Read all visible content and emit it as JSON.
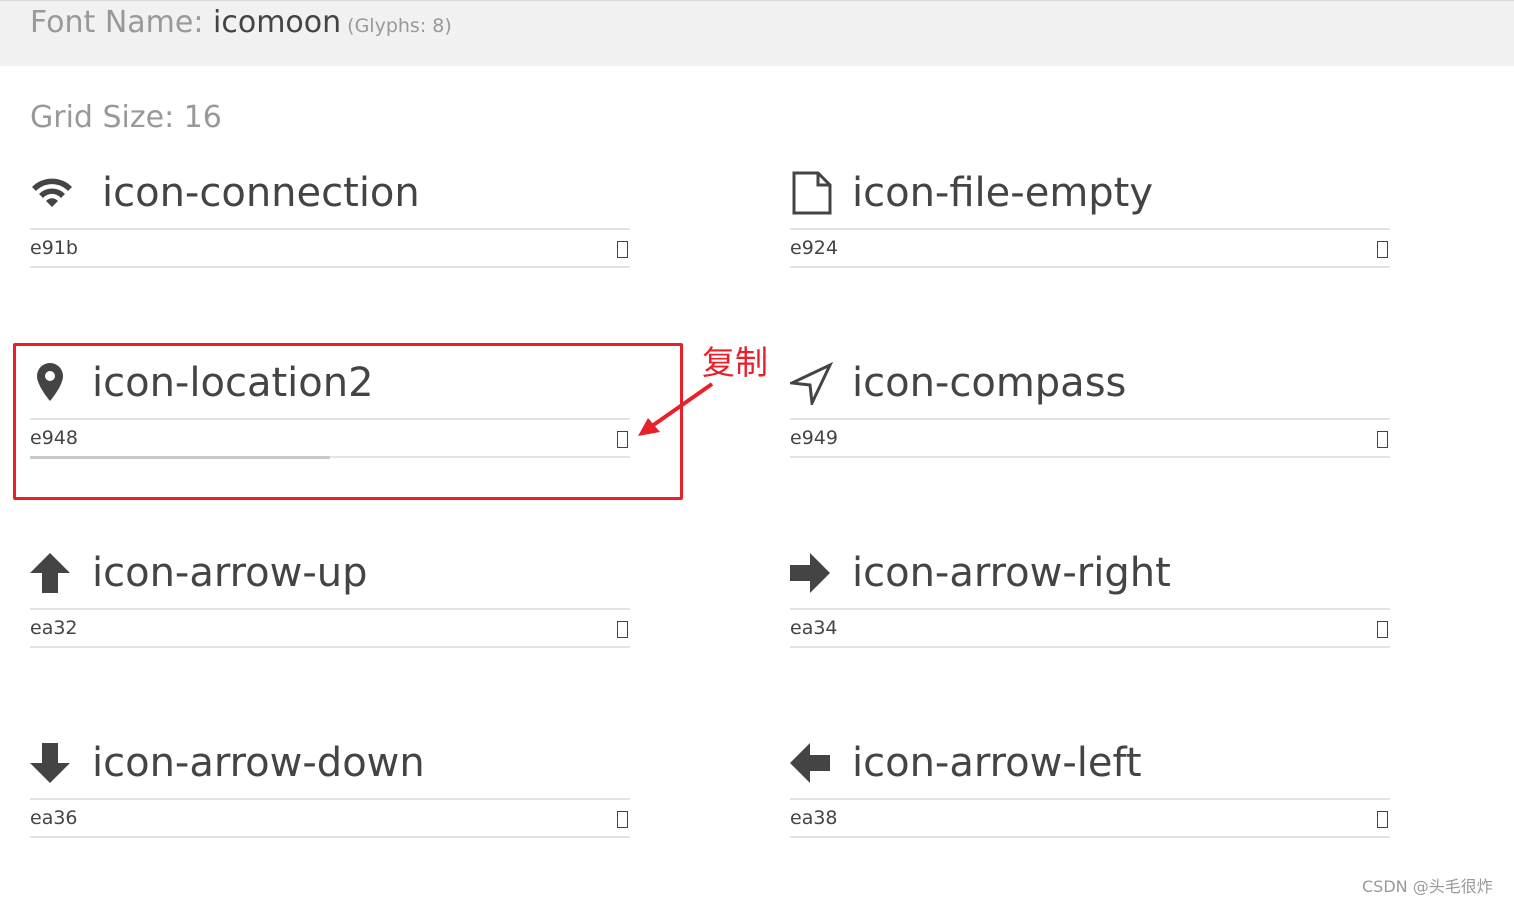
{
  "header": {
    "font_label": "Font Name:",
    "font_name": "icomoon",
    "glyphs_count": "(Glyphs: 8)"
  },
  "grid": {
    "label": "Grid Size: 16"
  },
  "glyphs": [
    {
      "name": "icon-connection",
      "code": "e91b",
      "icon": "wifi-icon"
    },
    {
      "name": "icon-file-empty",
      "code": "e924",
      "icon": "file-empty-icon"
    },
    {
      "name": "icon-location2",
      "code": "e948",
      "icon": "location-pin-icon"
    },
    {
      "name": "icon-compass",
      "code": "e949",
      "icon": "compass-arrow-icon"
    },
    {
      "name": "icon-arrow-up",
      "code": "ea32",
      "icon": "arrow-up-icon"
    },
    {
      "name": "icon-arrow-right",
      "code": "ea34",
      "icon": "arrow-right-icon"
    },
    {
      "name": "icon-arrow-down",
      "code": "ea36",
      "icon": "arrow-down-icon"
    },
    {
      "name": "icon-arrow-left",
      "code": "ea38",
      "icon": "arrow-left-icon"
    }
  ],
  "annotation": {
    "label": "复制",
    "color": "#e8202a"
  },
  "watermark": "CSDN @头毛很炸"
}
